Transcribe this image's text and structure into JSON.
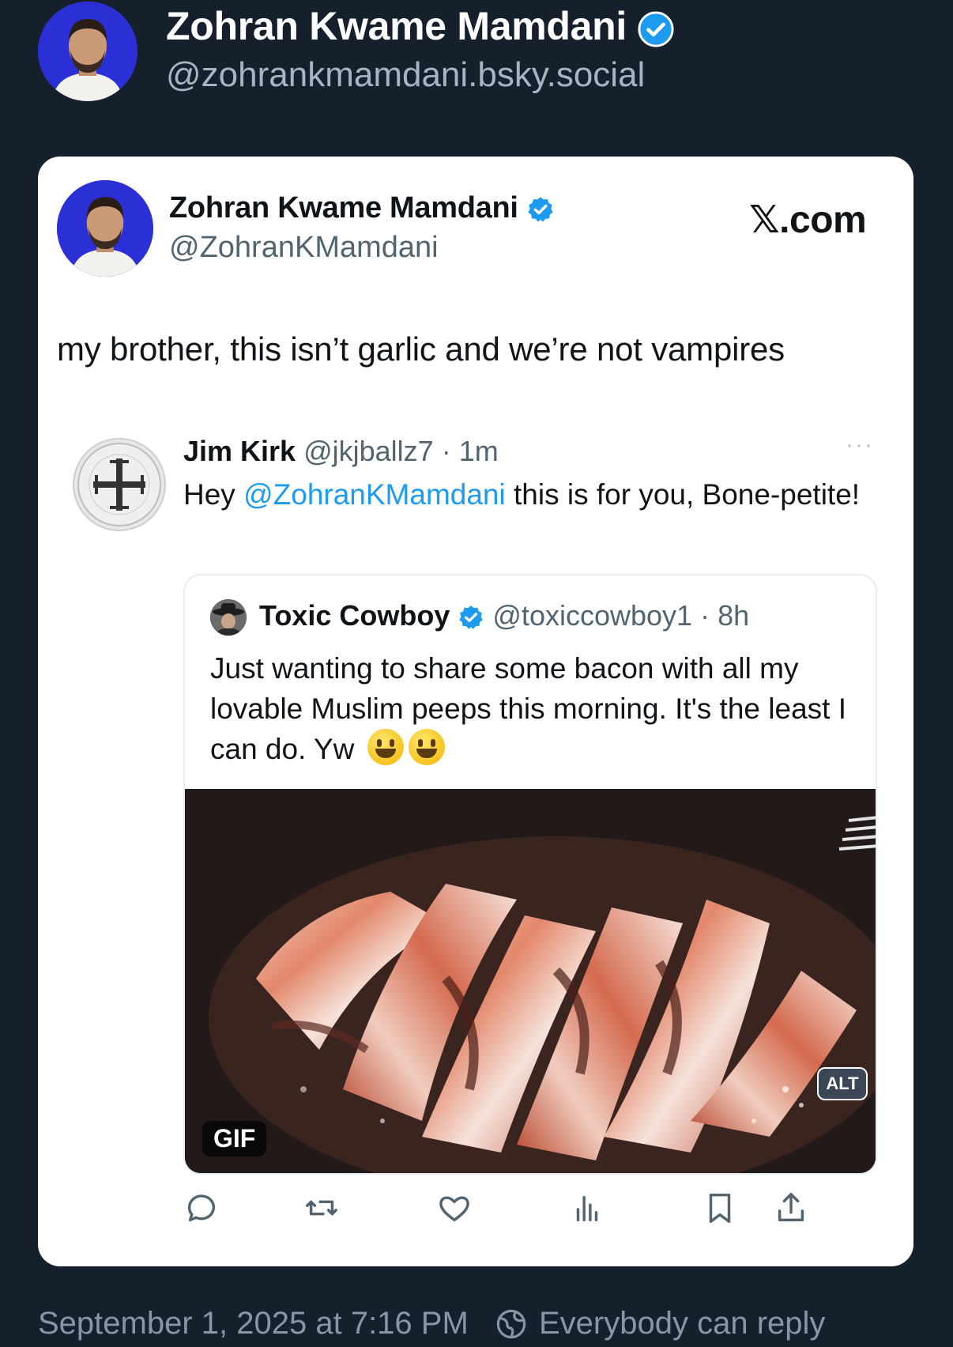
{
  "post_author": {
    "display_name": "Zohran Kwame Mamdani",
    "handle": "@zohrankmamdani.bsky.social",
    "verified": true
  },
  "embedded_screenshot": {
    "source_brand": "𝕏.com",
    "author": {
      "display_name": "Zohran Kwame Mamdani",
      "handle": "@ZohranKMamdani",
      "verified": true
    },
    "text": "my brother, this isn’t garlic and we’re not vampires",
    "reply_tweet": {
      "display_name": "Jim Kirk",
      "handle": "@jkjballz7",
      "separator": "·",
      "time": "1m",
      "text_prefix": "Hey ",
      "mention": "@ZohranKMamdani",
      "text_suffix": " this is for you, Bone-petite!",
      "more_label": "···",
      "quoted_tweet": {
        "display_name": "Toxic Cowboy",
        "handle": "@toxiccowboy1",
        "separator": "·",
        "time": "8h",
        "verified": true,
        "text": "Just wanting to share some bacon with all my lovable Muslim peeps this morning. It's the least I can do. Yw",
        "media_badge": "GIF"
      }
    },
    "actions": [
      "reply-icon",
      "repost-icon",
      "like-icon",
      "views-icon",
      "bookmark-icon",
      "share-icon"
    ]
  },
  "alt_badge": "ALT",
  "footer": {
    "timestamp": "September 1, 2025 at 7:16 PM",
    "reply_setting": "Everybody can reply"
  },
  "colors": {
    "background": "#16202c",
    "verified_blue": "#1d9bf0",
    "link_blue": "#1d9bf0",
    "muted_text": "#8596a8"
  }
}
